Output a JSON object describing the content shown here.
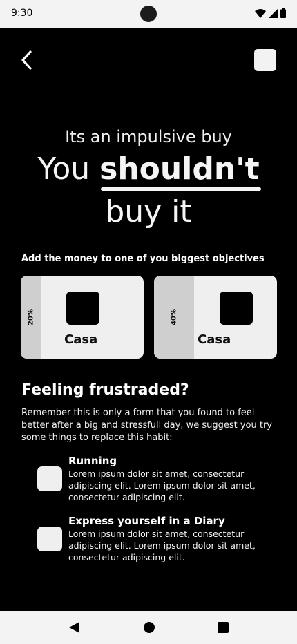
{
  "status_bar": {
    "time": "9:30",
    "icons": [
      "wifi-icon",
      "signal-icon",
      "battery-icon"
    ]
  },
  "header": {
    "back_icon": "chevron-left-icon"
  },
  "hero": {
    "subtitle": "Its an impulsive buy",
    "headline_prefix": "You",
    "headline_emphasis": "shouldn't",
    "headline_suffix": "buy it"
  },
  "objectives": {
    "caption": "Add the money to one of you biggest objectives",
    "items": [
      {
        "label": "Casa",
        "percent_label": "20%",
        "progress": 0.2
      },
      {
        "label": "Casa",
        "percent_label": "40%",
        "progress": 0.4
      }
    ]
  },
  "frustration": {
    "title": "Feeling frustraded?",
    "text": "Remember this is only a form that you found to feel better after a big and stressfull day, we suggest you try some things to replace this habit:",
    "habits": [
      {
        "title": "Running",
        "text": "Lorem ipsum dolor sit amet, consectetur adipiscing elit. Lorem ipsum dolor sit amet, consectetur adipiscing elit."
      },
      {
        "title": "Express yourself in a Diary",
        "text": "Lorem ipsum dolor sit amet, consectetur adipiscing elit. Lorem ipsum dolor sit amet, consectetur adipiscing elit."
      }
    ]
  },
  "nav_bar": {
    "icons": [
      "back-triangle-icon",
      "home-circle-icon",
      "recents-square-icon"
    ]
  },
  "colors": {
    "background": "#000000",
    "card": "#efefef",
    "card_bar": "#cfcfcf",
    "system_bar": "#f3f3f3"
  }
}
